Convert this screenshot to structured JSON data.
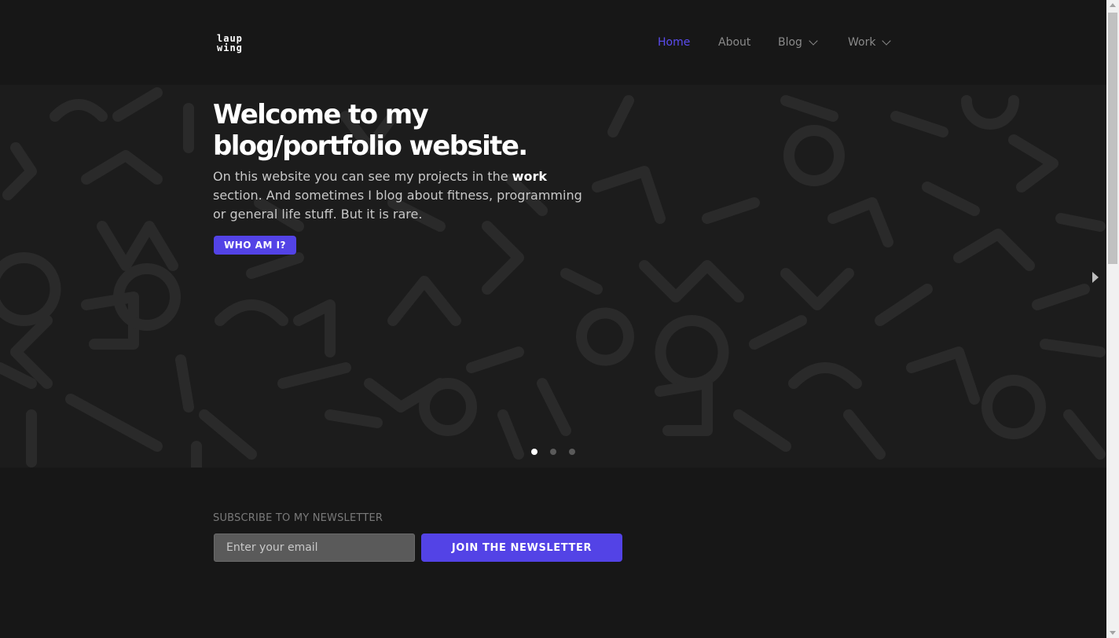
{
  "header": {
    "logo_line1": "LAUP",
    "logo_line2": "WING",
    "nav": {
      "home": "Home",
      "about": "About",
      "blog": "Blog",
      "work": "Work"
    }
  },
  "hero": {
    "title_line1": "Welcome to my",
    "title_line2": "blog/portfolio website.",
    "text_before": "On this website you can see my projects in the ",
    "text_bold": "work",
    "text_after": " section. And sometimes I blog about fitness, programming or general life stuff. But it is rare.",
    "button_label": "WHO AM I?",
    "slide_count": 3,
    "active_slide": 1
  },
  "newsletter": {
    "label": "SUBSCRIBE TO MY NEWSLETTER",
    "email_placeholder": "Enter your email",
    "button_label": "JOIN THE NEWSLETTER"
  },
  "colors": {
    "accent": "#5343e6",
    "nav_active": "#5b4cf0",
    "background": "#171717",
    "hero_background": "#1c1c1c",
    "pattern": "#2a2a2a"
  },
  "icons": {
    "blog_dropdown": "chevron-down-icon",
    "work_dropdown": "chevron-down-icon",
    "slider_next": "caret-right-icon"
  }
}
